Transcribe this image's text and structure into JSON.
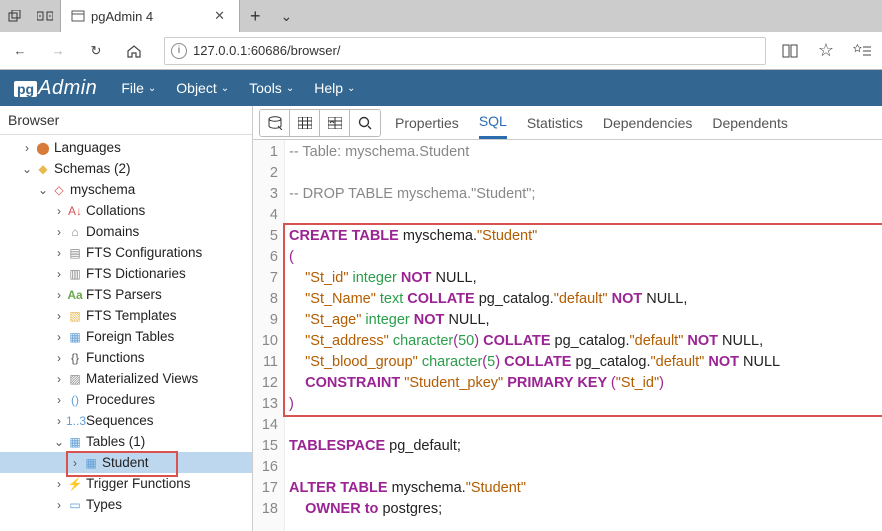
{
  "chrome": {
    "tab_title": "pgAdmin 4",
    "url": "127.0.0.1:60686/browser/"
  },
  "pga_menu": [
    "File",
    "Object",
    "Tools",
    "Help"
  ],
  "browser_panel_title": "Browser",
  "tree": {
    "languages": "Languages",
    "schemas": "Schemas (2)",
    "myschema": "myschema",
    "collations": "Collations",
    "domains": "Domains",
    "fts_conf": "FTS Configurations",
    "fts_dict": "FTS Dictionaries",
    "fts_parsers": "FTS Parsers",
    "fts_templates": "FTS Templates",
    "foreign_tables": "Foreign Tables",
    "functions": "Functions",
    "mat_views": "Materialized Views",
    "procedures": "Procedures",
    "sequences": "Sequences",
    "tables": "Tables (1)",
    "student": "Student",
    "trigger_fns": "Trigger Functions",
    "types": "Types"
  },
  "tabs": {
    "properties": "Properties",
    "sql": "SQL",
    "statistics": "Statistics",
    "dependencies": "Dependencies",
    "dependents": "Dependents"
  },
  "code": {
    "l1a": "-- Table: myschema.Student",
    "l3a": "-- DROP TABLE myschema.\"Student\";",
    "l5_kw": "CREATE TABLE ",
    "l5_rest": "myschema.",
    "l5_str": "\"Student\"",
    "l6": "(",
    "l7_pad": "    ",
    "l7_str": "\"St_id\"",
    "l7_sp": " ",
    "l7_type": "integer",
    "l7_kw": " NOT ",
    "l7_null": "NULL",
    "l7_c": ",",
    "l8_str": "\"St_Name\"",
    "l8_type": "text",
    "l8_kw_col": " COLLATE ",
    "l8_id": "pg_catalog.",
    "l8_def": "\"default\"",
    "l9_str": "\"St_age\"",
    "l10_str": "\"St_address\"",
    "l10_type": "character",
    "l10_num": "50",
    "l11_str": "\"St_blood_group\"",
    "l11_num": "5",
    "l12_kw_con": "CONSTRAINT ",
    "l12_str": "\"Student_pkey\"",
    "l12_kw_pk": " PRIMARY KEY ",
    "l12_id": "\"St_id\"",
    "l13": ")",
    "l15_kw": "TABLESPACE ",
    "l15_id": "pg_default;",
    "l17_kw": "ALTER TABLE ",
    "l17_rest": "myschema.",
    "l17_str": "\"Student\"",
    "l18_pad": "    ",
    "l18_kw": "OWNER to ",
    "l18_id": "postgres;"
  }
}
